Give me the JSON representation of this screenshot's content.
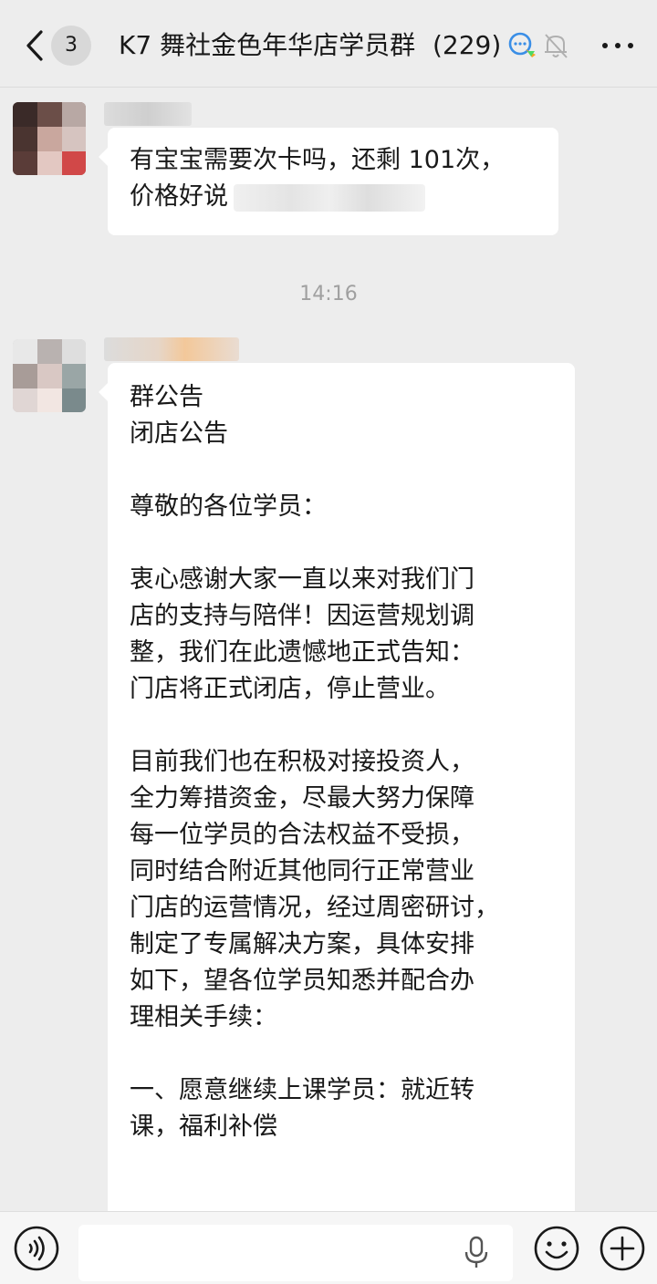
{
  "header": {
    "back_badge": "3",
    "title": "K7 舞社金色年华店学员群",
    "member_count": "(229)"
  },
  "messages": [
    {
      "lines": [
        "有宝宝需要次卡吗，还剩 101次，",
        "价格好说"
      ]
    }
  ],
  "timestamp": "14:16",
  "announcement": {
    "lines": [
      "群公告",
      "闭店公告",
      "",
      "尊敬的各位学员：",
      "",
      "衷心感谢大家一直以来对我们门",
      "店的支持与陪伴！因运营规划调",
      "整，我们在此遗憾地正式告知：",
      "门店将正式闭店，停止营业。",
      "",
      "目前我们也在积极对接投资人，",
      "全力筹措资金，尽最大努力保障",
      "每一位学员的合法权益不受损，",
      "同时结合附近其他同行正常营业",
      "门店的运营情况，经过周密研讨，",
      "制定了专属解决方案，具体安排",
      "如下，望各位学员知悉并配合办",
      "理相关手续：",
      "",
      "一、愿意继续上课学员：就近转",
      "课，福利补偿"
    ]
  },
  "input_bar": {
    "placeholder": ""
  },
  "colors": {
    "background": "#ededed",
    "bubble": "#ffffff",
    "text": "#191919",
    "timestamp": "#a0a0a0"
  },
  "icons": [
    "back-chevron-icon",
    "group-chat-icon",
    "mute-bell-icon",
    "more-dots-icon",
    "voice-icon",
    "microphone-icon",
    "emoji-icon",
    "plus-icon"
  ]
}
